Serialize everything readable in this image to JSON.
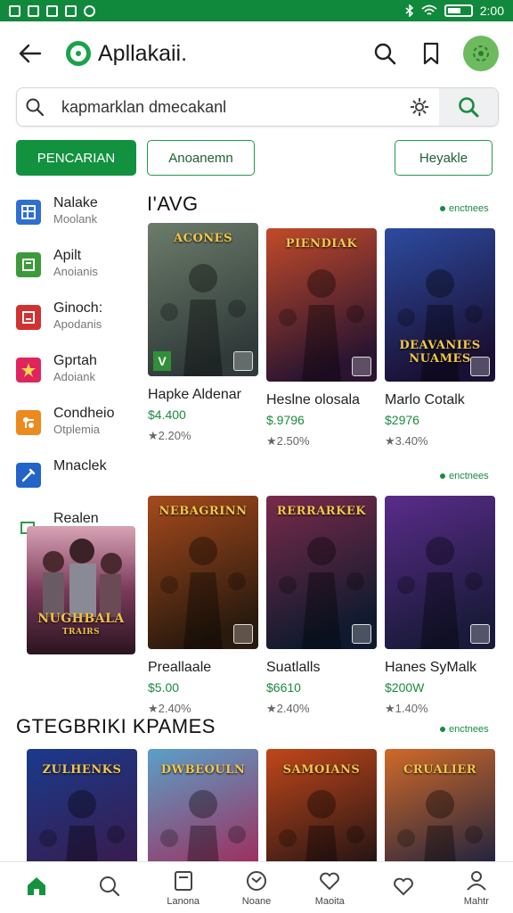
{
  "status_bar": {
    "time": "2:00"
  },
  "app": {
    "title": "Apllakaii."
  },
  "search": {
    "value": "kapmarklan dmecakanl",
    "placeholder": "kapmarklan dmecakanl"
  },
  "chips": [
    "PENCARIAN",
    "Anoanemn",
    "Heyakle"
  ],
  "sidebar": [
    {
      "title": "Nalake",
      "sub": "Moolank",
      "color": "#2f6fd1",
      "icon": "grid-icon"
    },
    {
      "title": "Apilt",
      "sub": "Anoianis",
      "color": "#3c9a3a",
      "icon": "square-icon"
    },
    {
      "title": "Ginoch:",
      "sub": "Apodanis",
      "color": "#d03232",
      "icon": "box-icon"
    },
    {
      "title": "Gprtah",
      "sub": "Adoiank",
      "color": "#e0245e",
      "icon": "star-icon"
    },
    {
      "title": "Condheio",
      "sub": "Otplemia",
      "color": "#ec8a1e",
      "icon": "puzzle-icon"
    },
    {
      "title": "Mnaclek",
      "sub": "",
      "color": "#2264c8",
      "icon": "tool-icon"
    },
    {
      "title": "Realen",
      "sub": "",
      "color": "#2f9a48",
      "icon": "chat-icon"
    }
  ],
  "promo": {
    "title": "NUGHBALA",
    "sub": "TRAIRS"
  },
  "sections": [
    {
      "heading": "I'AVG",
      "see_more": "enctnees",
      "items": [
        {
          "title": "Hapke Aldenar",
          "price": "$4.400",
          "rating": "★2.20%",
          "art_title": "ACONES",
          "colors": [
            "#6c7d6a",
            "#303a3a"
          ]
        },
        {
          "title": "Heslne olosala",
          "price": "$.9796",
          "rating": "★2.50%",
          "art_title": "PIENDIAK",
          "colors": [
            "#c24a2a",
            "#2a1430"
          ]
        },
        {
          "title": "Marlo Cotalk",
          "price": "$2976",
          "rating": "★3.40%",
          "art_title": "DEAVANIES NUAMES",
          "colors": [
            "#2d4ba0",
            "#1a1033"
          ]
        }
      ]
    },
    {
      "heading": "",
      "see_more": "enctnees",
      "items": [
        {
          "title": "Preallaale",
          "price": "$5.00",
          "rating": "★2.40%",
          "art_title": "NEBAGRINN",
          "colors": [
            "#a64a1c",
            "#2a1a0e"
          ]
        },
        {
          "title": "Suatlalls",
          "price": "$6610",
          "rating": "★2.40%",
          "art_title": "RERRARKEK",
          "colors": [
            "#7a2a4a",
            "#0f1a2e"
          ]
        },
        {
          "title": "Hanes SyMalk",
          "price": "$200W",
          "rating": "★1.40%",
          "art_title": "",
          "colors": [
            "#5a2c8a",
            "#1a1a3a"
          ]
        }
      ]
    },
    {
      "heading": "GTEGBRIKI KPAMES",
      "see_more": "enctnees",
      "items": [
        {
          "title": "",
          "price": "",
          "rating": "",
          "art_title": "ZULHENKS",
          "colors": [
            "#1a3a8c",
            "#3a1a4a"
          ]
        },
        {
          "title": "",
          "price": "",
          "rating": "",
          "art_title": "DWBEOULN",
          "colors": [
            "#5aa0c8",
            "#a02a5a"
          ]
        },
        {
          "title": "",
          "price": "",
          "rating": "",
          "art_title": "SAMOIANS",
          "colors": [
            "#c0471a",
            "#1e1214"
          ]
        },
        {
          "title": "",
          "price": "",
          "rating": "",
          "art_title": "CRUALIER",
          "colors": [
            "#d06a28",
            "#1a2040"
          ]
        }
      ]
    }
  ],
  "bottom_nav": [
    {
      "label": "",
      "icon": "home-icon",
      "active": true
    },
    {
      "label": "",
      "icon": "search-icon",
      "active": false
    },
    {
      "label": "Lanona",
      "icon": "library-icon",
      "active": false
    },
    {
      "label": "Noane",
      "icon": "compass-icon",
      "active": false
    },
    {
      "label": "Maoita",
      "icon": "heart-icon",
      "active": false
    },
    {
      "label": "",
      "icon": "heart-outline-icon",
      "active": false
    },
    {
      "label": "Mahtr",
      "icon": "user-icon",
      "active": false
    }
  ],
  "colors": {
    "brand": "#12923f",
    "status_bar": "#11893c"
  }
}
